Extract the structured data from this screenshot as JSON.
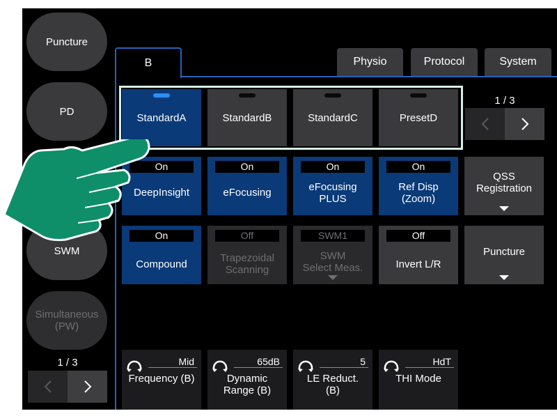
{
  "left": {
    "buttons": [
      {
        "label": "Puncture"
      },
      {
        "label": "PD"
      },
      {
        "label": "SWM"
      },
      {
        "label": "Simultaneous\n(PW)"
      }
    ],
    "pager": {
      "label": "1 / 3"
    }
  },
  "tabs": [
    {
      "label": "B",
      "active": true
    },
    {
      "label": "Physio"
    },
    {
      "label": "Protocol"
    },
    {
      "label": "System"
    }
  ],
  "presets": [
    {
      "label": "StandardA",
      "selected": true
    },
    {
      "label": "StandardB"
    },
    {
      "label": "StandardC"
    },
    {
      "label": "PresetD"
    }
  ],
  "right_pager": {
    "label": "1 / 3"
  },
  "row1": [
    {
      "state": "On",
      "label": "DeepInsight"
    },
    {
      "state": "On",
      "label": "eFocusing"
    },
    {
      "state": "On",
      "label": "eFocusing\nPLUS"
    },
    {
      "state": "On",
      "label": "Ref Disp\n(Zoom)"
    }
  ],
  "qss": {
    "label": "QSS\nRegistration"
  },
  "row2": [
    {
      "state": "On",
      "label": "Compound"
    },
    {
      "state": "Off",
      "label": "Trapezoidal\nScanning"
    },
    {
      "state": "SWM1",
      "label": "SWM\nSelect Meas."
    },
    {
      "state": "Off",
      "label": "Invert L/R"
    }
  ],
  "puncture_side": {
    "label": "Puncture"
  },
  "knobs": [
    {
      "value": "Mid",
      "label": "Frequency (B)"
    },
    {
      "value": "65dB",
      "label": "Dynamic\nRange (B)"
    },
    {
      "value": "5",
      "label": "LE Reduct.\n(B)"
    },
    {
      "value": "HdT",
      "label": "THI Mode"
    }
  ],
  "colors": {
    "selected": "#0a3a78",
    "accent": "#2563b8",
    "hand": "#0e8f6a"
  },
  "icons": {
    "pager_prev": "chevron-left-icon",
    "pager_next": "chevron-right-icon",
    "knob": "knob-icon",
    "pointer": "pointing-hand-icon"
  }
}
